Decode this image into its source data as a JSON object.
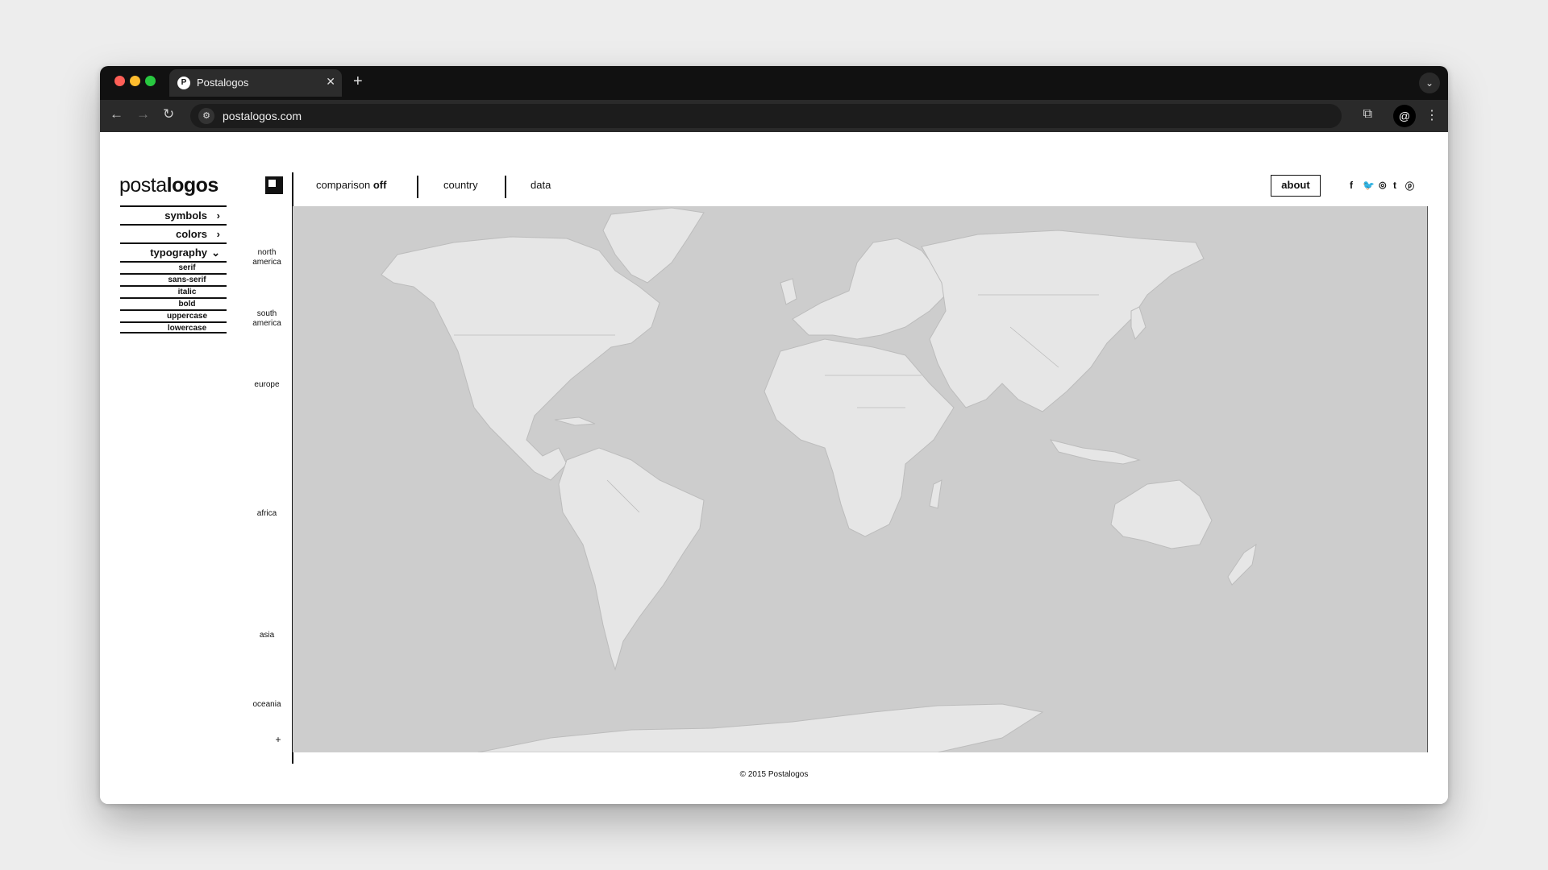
{
  "browser": {
    "tab_title": "Postalogos",
    "tab_favicon": "P",
    "new_tab": "+",
    "url": "postalogos.com"
  },
  "site": {
    "logo_regular": "posta",
    "logo_bold": "logos",
    "nav": {
      "comparison_label": "comparison",
      "comparison_state": "off",
      "country": "country",
      "data": "data"
    },
    "about": "about",
    "social": [
      "f",
      "t",
      "ig",
      "t",
      "p"
    ]
  },
  "sidebar": {
    "items": [
      {
        "label": "symbols",
        "chevron": "›"
      },
      {
        "label": "colors",
        "chevron": "›"
      },
      {
        "label": "typography",
        "chevron": "⌄"
      }
    ],
    "typography_sub": [
      "serif",
      "sans-serif",
      "italic",
      "bold",
      "uppercase",
      "lowercase"
    ]
  },
  "continents": {
    "north_america_1": "north",
    "north_america_2": "america",
    "south_america_1": "south",
    "south_america_2": "america",
    "europe": "europe",
    "africa": "africa",
    "asia": "asia",
    "oceania": "oceania",
    "plus": "+"
  },
  "map": {
    "ocean_color": "#cdcdcd",
    "land_color": "#e6e6e6",
    "border_color": "#bcbcbc"
  },
  "footer": "© 2015 Postalogos"
}
